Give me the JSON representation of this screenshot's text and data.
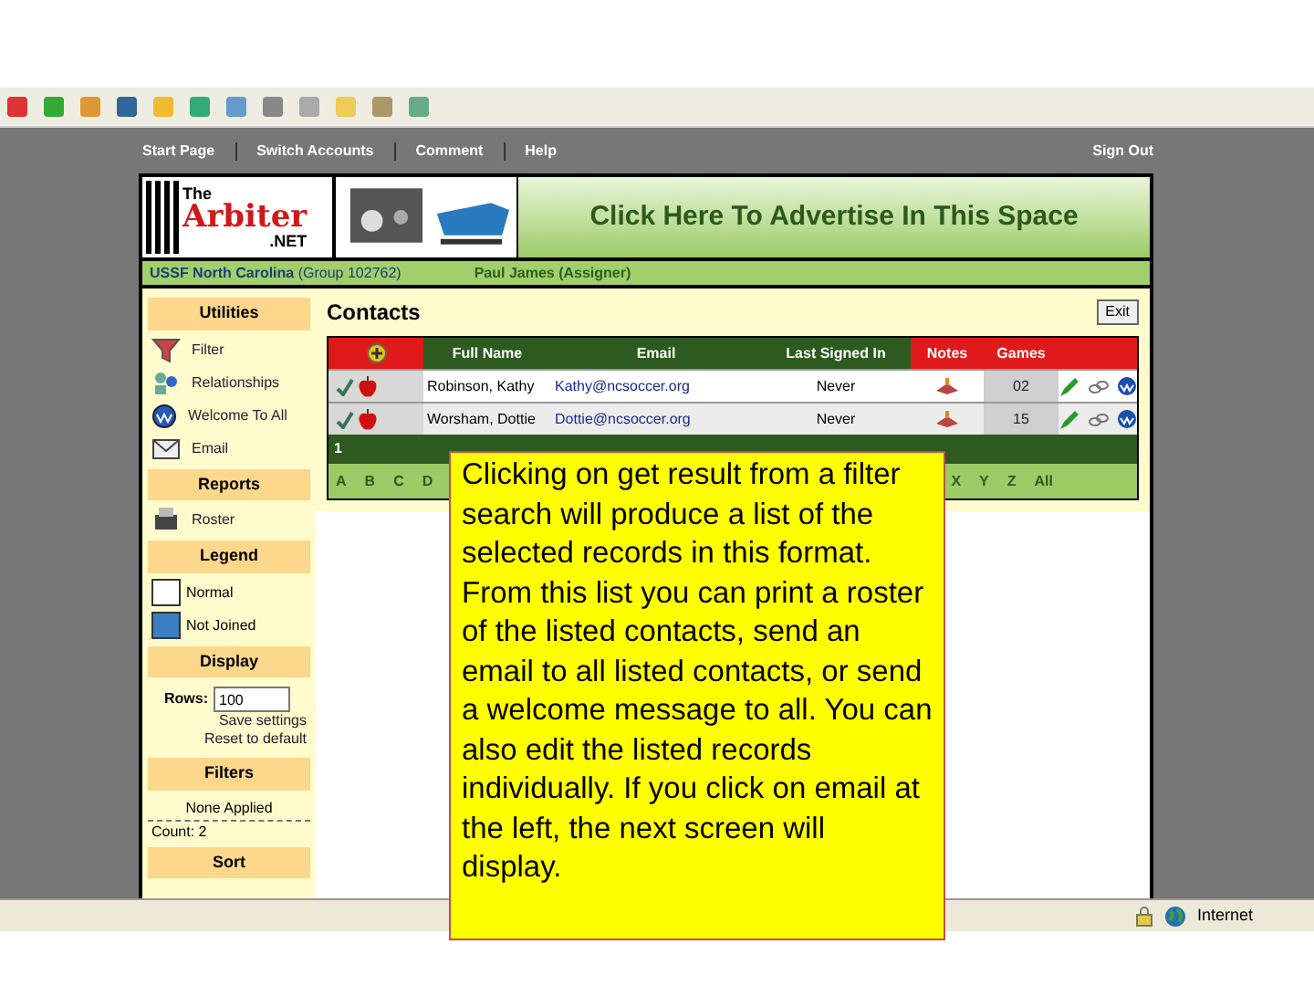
{
  "nav": [
    {
      "label": "Start Page"
    },
    {
      "label": "Switch Accounts"
    },
    {
      "label": "Comment"
    },
    {
      "label": "Help"
    }
  ],
  "sign_out": "Sign Out",
  "banner": {
    "logo_top": "The",
    "logo_main": "Arbiter",
    "logo_bottom": ".NET",
    "ad": "Click Here To Advertise In This Space"
  },
  "group_bar": {
    "org": "USSF North Carolina",
    "group": "(Group 102762)",
    "user": "Paul James (Assigner)"
  },
  "sidebar": [
    {
      "kind": "links",
      "title": "Utilities",
      "items": [
        {
          "label": "Filter"
        },
        {
          "label": "Relationships"
        },
        {
          "label": "Welcome To All"
        },
        {
          "label": "Email"
        }
      ]
    },
    {
      "kind": "links",
      "title": "Reports",
      "items": [
        {
          "label": "Roster"
        }
      ]
    },
    {
      "kind": "legend",
      "title": "Legend",
      "items": [
        {
          "label": "Normal",
          "color": "#ffffff"
        },
        {
          "label": "Not Joined",
          "color": "#3b7fc0"
        }
      ]
    },
    {
      "kind": "display",
      "title": "Display",
      "rows_label": "Rows:",
      "rows_value": "100",
      "links": [
        "Save settings",
        "Reset to default"
      ]
    },
    {
      "kind": "filters",
      "title": "Filters",
      "status": "None Applied",
      "count": "Count: 2"
    },
    {
      "kind": "header",
      "title": "Sort"
    }
  ],
  "main": {
    "title": "Contacts",
    "exit": "Exit",
    "columns": [
      "Full Name",
      "Email",
      "Last Signed In",
      "Notes",
      "Games"
    ],
    "rows": [
      {
        "name": "Robinson, Kathy",
        "email": "Kathy@ncsoccer.org",
        "last": "Never",
        "games": "02"
      },
      {
        "name": "Worsham, Dottie",
        "email": "Dottie@ncsoccer.org",
        "last": "Never",
        "games": "15"
      }
    ],
    "page": "1",
    "letters_left": [
      "A",
      "B",
      "C",
      "D"
    ],
    "letters_right": [
      "X",
      "Y",
      "Z",
      "All"
    ]
  },
  "callout": "Clicking on get result from a filter search will produce a list of the selected records in this format.  From this list you can print a roster of the listed contacts, send an email to all listed contacts, or send a welcome message to all.  You can also edit the listed records individually. If you click on email at the left, the next screen will display.",
  "status_bar": {
    "zone": "Internet"
  }
}
